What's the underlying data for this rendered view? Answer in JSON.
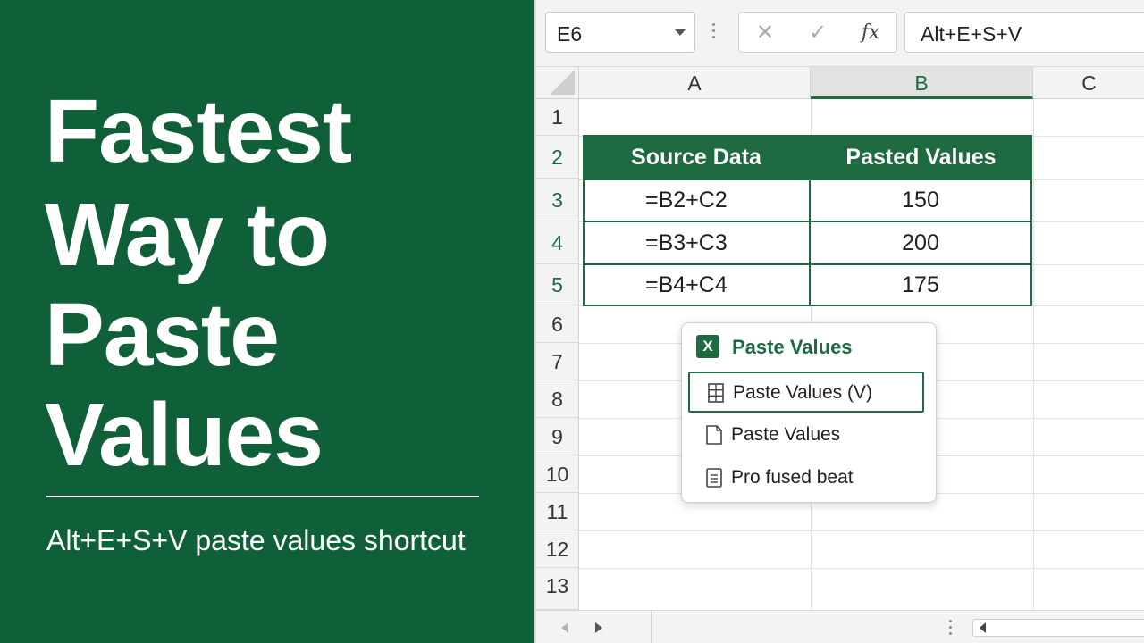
{
  "hero": {
    "title_lines": [
      "Fastest",
      "Way to",
      "Paste",
      "Values"
    ],
    "subtitle": "Alt+E+S+V paste values shortcut",
    "background_color": "#0f6039"
  },
  "formula_bar": {
    "name_box": "E6",
    "cancel_icon": "✕",
    "enter_icon": "✓",
    "fx_label": "fx",
    "formula": "Alt+E+S+V"
  },
  "columns": [
    {
      "label": "A",
      "active": false
    },
    {
      "label": "B",
      "active": true
    },
    {
      "label": "C",
      "active": false
    }
  ],
  "rows": [
    "1",
    "2",
    "3",
    "4",
    "5",
    "6",
    "7",
    "8",
    "9",
    "10",
    "11",
    "12",
    "13"
  ],
  "table": {
    "headers": [
      "Source Data",
      "Pasted Values"
    ],
    "rows": [
      [
        "=B2+C2",
        "150"
      ],
      [
        "=B3+C3",
        "200"
      ],
      [
        "=B4+C4",
        "175"
      ]
    ],
    "accent_color": "#1e6b41"
  },
  "context_menu": {
    "title": "Paste Values",
    "app_icon": "excel-icon",
    "items": [
      {
        "label": "Paste Values (V)",
        "icon": "grid-icon",
        "selected": true
      },
      {
        "label": "Paste Values",
        "icon": "page-icon",
        "selected": false
      },
      {
        "label": "Pro fused beat",
        "icon": "list-document-icon",
        "selected": false
      }
    ]
  }
}
